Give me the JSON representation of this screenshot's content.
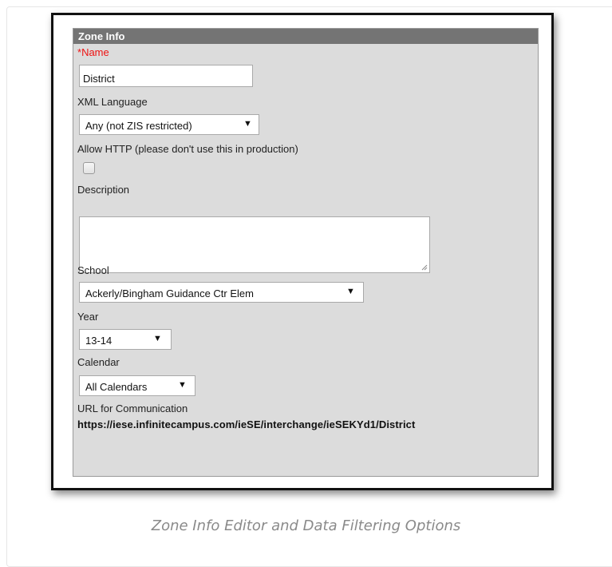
{
  "panel": {
    "header": "Zone Info",
    "name_required_marker": "*",
    "name_label": "Name",
    "name_value": "District",
    "xml_language_label": "XML Language",
    "xml_language_value": "Any (not ZIS restricted)",
    "allow_http_label": "Allow HTTP (please don't use this in production)",
    "allow_http_checked": false,
    "description_label": "Description",
    "description_value": "",
    "school_label": "School",
    "school_value": "Ackerly/Bingham Guidance Ctr Elem",
    "year_label": "Year",
    "year_value": "13-14",
    "calendar_label": "Calendar",
    "calendar_value": "All Calendars",
    "url_label": "URL for Communication",
    "url_value": "https://iese.infinitecampus.com/ieSE/interchange/ieSEKYd1/District"
  },
  "caption": "Zone Info Editor and Data Filtering Options",
  "icons": {
    "dropdown": "triangle-down-icon",
    "resize": "resize-grip-icon"
  },
  "colors": {
    "header_bg": "#747474",
    "panel_bg": "#dcdcdc",
    "required": "#ee1111"
  }
}
